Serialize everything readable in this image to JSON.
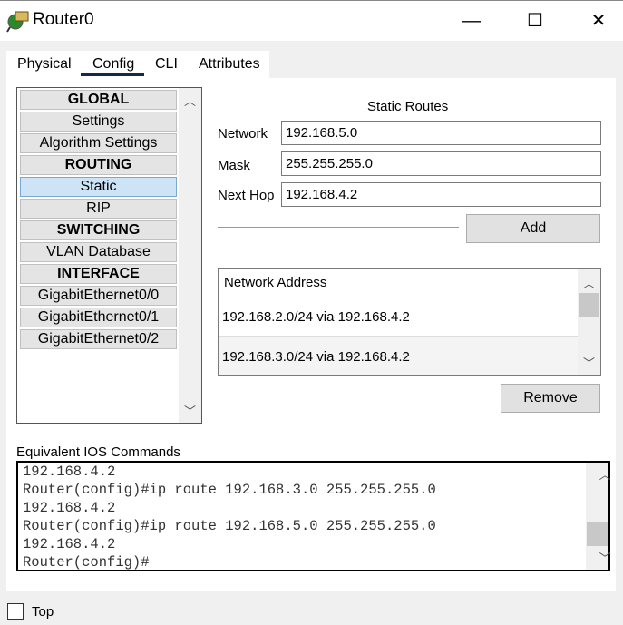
{
  "window": {
    "title": "Router0",
    "minimize": "—",
    "maximize": "☐",
    "close": "✕"
  },
  "tabs": [
    {
      "label": "Physical"
    },
    {
      "label": "Config"
    },
    {
      "label": "CLI"
    },
    {
      "label": "Attributes"
    }
  ],
  "active_tab": "Config",
  "nav": [
    {
      "label": "GLOBAL",
      "header": true
    },
    {
      "label": "Settings"
    },
    {
      "label": "Algorithm Settings"
    },
    {
      "label": "ROUTING",
      "header": true
    },
    {
      "label": "Static",
      "selected": true
    },
    {
      "label": "RIP"
    },
    {
      "label": "SWITCHING",
      "header": true
    },
    {
      "label": "VLAN Database"
    },
    {
      "label": "INTERFACE",
      "header": true
    },
    {
      "label": "GigabitEthernet0/0"
    },
    {
      "label": "GigabitEthernet0/1"
    },
    {
      "label": "GigabitEthernet0/2"
    }
  ],
  "static_routes": {
    "title": "Static Routes",
    "network_label": "Network",
    "network_value": "192.168.5.0",
    "mask_label": "Mask",
    "mask_value": "255.255.255.0",
    "nexthop_label": "Next Hop",
    "nexthop_value": "192.168.4.2",
    "add_label": "Add",
    "list_header": "Network Address",
    "routes": [
      "192.168.2.0/24 via 192.168.4.2",
      "192.168.3.0/24 via 192.168.4.2"
    ],
    "remove_label": "Remove"
  },
  "ios": {
    "label": "Equivalent IOS Commands",
    "lines": [
      "192.168.4.2",
      "Router(config)#ip route 192.168.3.0 255.255.255.0",
      "192.168.4.2",
      "Router(config)#ip route 192.168.5.0 255.255.255.0",
      "192.168.4.2",
      "Router(config)#"
    ]
  },
  "top_checkbox": {
    "label": "Top",
    "checked": false
  }
}
